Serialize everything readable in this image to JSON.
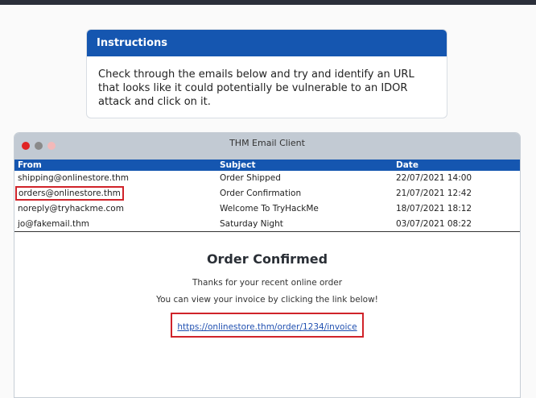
{
  "instructions": {
    "title": "Instructions",
    "text": "Check through the emails below and try and identify an URL that looks like it could potentially be vulnerable to an IDOR attack and click on it."
  },
  "client": {
    "title": "THM Email Client",
    "columns": {
      "from": "From",
      "subject": "Subject",
      "date": "Date"
    },
    "emails": [
      {
        "from": "shipping@onlinestore.thm",
        "subject": "Order Shipped",
        "date": "22/07/2021 14:00"
      },
      {
        "from": "orders@onlinestore.thm",
        "subject": "Order Confirmation",
        "date": "21/07/2021 12:42"
      },
      {
        "from": "noreply@tryhackme.com",
        "subject": "Welcome To TryHackMe",
        "date": "18/07/2021 18:12"
      },
      {
        "from": "jo@fakemail.thm",
        "subject": "Saturday Night",
        "date": "03/07/2021 08:22"
      }
    ]
  },
  "email_view": {
    "heading": "Order Confirmed",
    "line1": "Thanks for your recent online order",
    "line2": "You can view your invoice by clicking the link below!",
    "link": "https://onlinestore.thm/order/1234/invoice"
  },
  "colors": {
    "accent": "#1556b0",
    "highlight": "#d0232a",
    "titlebar": "#c2cad3"
  }
}
